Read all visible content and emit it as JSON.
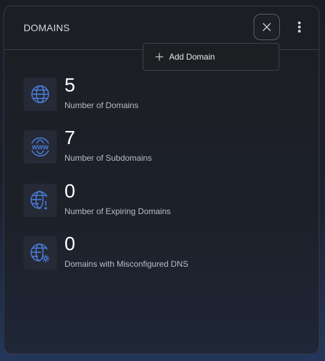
{
  "card": {
    "title": "DOMAINS"
  },
  "header": {
    "close_icon": "close-icon",
    "more_icon": "more-vertical-icon"
  },
  "dropdown": {
    "items": [
      {
        "label": "Add Domain",
        "icon": "plus-icon"
      }
    ]
  },
  "stats": [
    {
      "value": "5",
      "label": "Number of Domains",
      "icon": "globe-icon"
    },
    {
      "value": "7",
      "label": "Number of Subdomains",
      "icon": "www-globe-icon"
    },
    {
      "value": "0",
      "label": "Number of Expiring Domains",
      "icon": "globe-alert-icon"
    },
    {
      "value": "0",
      "label": "Domains with Misconfigured DNS",
      "icon": "globe-gear-icon"
    }
  ],
  "colors": {
    "icon_accent": "#4d7fe0",
    "background": "#1c1e23",
    "text_primary": "#ffffff",
    "text_secondary": "#b9bdc4"
  }
}
